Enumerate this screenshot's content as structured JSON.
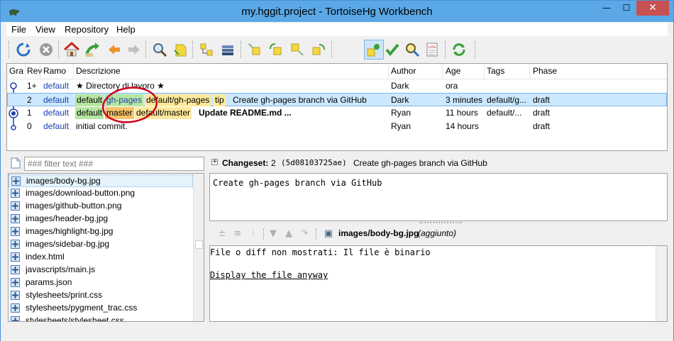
{
  "window": {
    "title": "my.hggit.project - TortoiseHg Workbench",
    "minimize_glyph": "—",
    "maximize_glyph": "☐",
    "close_glyph": "✕"
  },
  "menu": {
    "items": [
      "File",
      "View",
      "Repository",
      "Help"
    ]
  },
  "toolbar": {
    "icons": [
      "refresh-icon",
      "stop-icon",
      "home-icon",
      "goto-icon",
      "back-icon",
      "forward-icon",
      "search-icon",
      "filter-icon",
      "branch-icon",
      "stack-icon",
      "incoming-icon",
      "pull-icon",
      "outgoing-icon",
      "push-icon",
      "workbench-icon",
      "commit-icon",
      "search-file-icon",
      "log-icon",
      "sync-icon"
    ]
  },
  "graph": {
    "columns": [
      "Gra",
      "Rev",
      "Ramo",
      "Descrizione",
      "Author",
      "Age",
      "Tags",
      "Phase"
    ],
    "rows": [
      {
        "rev": "1+",
        "branch": "default",
        "description": "★ Directory di lavoro ★",
        "author": "Dark",
        "age": "ora",
        "tags": "",
        "phase": ""
      },
      {
        "rev": "2",
        "branch": "default",
        "labels": [
          "default",
          "gh-pages",
          "default/gh-pages",
          "tip"
        ],
        "description": "Create gh-pages branch via GitHub",
        "author": "Dark",
        "age": "3 minutes",
        "tags": "default/g...",
        "phase": "draft"
      },
      {
        "rev": "1",
        "branch": "default",
        "labels": [
          "default",
          "master",
          "default/master"
        ],
        "description": "Update README.md ...",
        "author": "Ryan",
        "age": "11 hours",
        "tags": "default/...",
        "phase": "draft"
      },
      {
        "rev": "0",
        "branch": "default",
        "description": "initial commit.",
        "author": "Ryan",
        "age": "14 hours",
        "tags": "",
        "phase": "draft"
      }
    ],
    "colors": {
      "selected_bg": "#cce8ff",
      "annotation": "#d0021b"
    }
  },
  "filter": {
    "placeholder": "### filter text ###"
  },
  "files": [
    "images/body-bg.jpg",
    "images/download-button.png",
    "images/github-button.png",
    "images/header-bg.jpg",
    "images/highlight-bg.jpg",
    "images/sidebar-bg.jpg",
    "index.html",
    "javascripts/main.js",
    "params.json",
    "stylesheets/print.css",
    "stylesheets/pygment_trac.css",
    "stylesheets/stylesheet.css"
  ],
  "changeset": {
    "label": "Changeset:",
    "rev": "2",
    "hash": "(5d08103725ae)",
    "summary": "Create gh-pages branch via GitHub",
    "message": "Create gh-pages branch via GitHub"
  },
  "diff": {
    "file": "images/body-bg.jpg",
    "status": "(aggiunto)",
    "notice": "File o diff non mostrati: Il file è binario",
    "link": "Display the file anyway"
  }
}
